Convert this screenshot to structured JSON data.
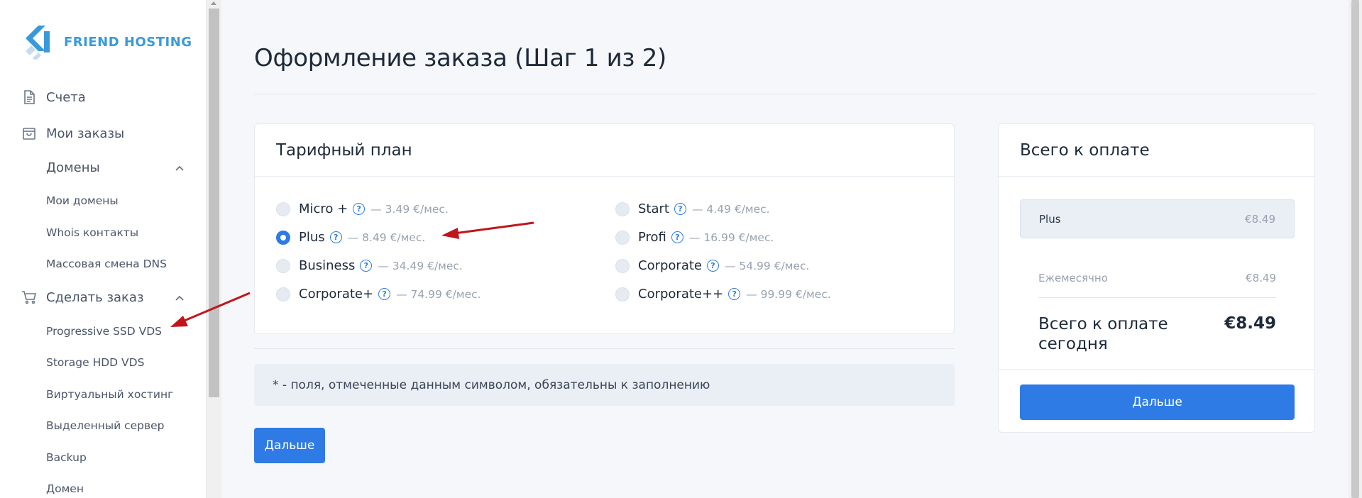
{
  "brand": {
    "name": "FRIEND HOSTING",
    "color": "#3a9ad9"
  },
  "sidebar": {
    "items": [
      {
        "label": "Счета",
        "icon": "document-icon"
      },
      {
        "label": "Мои заказы",
        "icon": "shopping-bag-icon"
      }
    ],
    "domains_group": {
      "label": "Домены",
      "items": [
        "Мои домены",
        "Whois контакты",
        "Массовая смена DNS"
      ]
    },
    "order_group": {
      "label": "Сделать заказ",
      "icon": "cart-icon",
      "items": [
        "Progressive SSD VDS",
        "Storage HDD VDS",
        "Виртуальный хостинг",
        "Выделенный сервер",
        "Backup",
        "Домен"
      ]
    }
  },
  "main": {
    "title": "Оформление заказа (Шаг 1 из 2)",
    "plan_card": {
      "title": "Тарифный план",
      "plans": [
        {
          "name": "Micro +",
          "price": "— 3.49 €/мес.",
          "selected": false
        },
        {
          "name": "Start",
          "price": "— 4.49 €/мес.",
          "selected": false
        },
        {
          "name": "Plus",
          "price": "— 8.49 €/мес.",
          "selected": true
        },
        {
          "name": "Profi",
          "price": "— 16.99 €/мес.",
          "selected": false
        },
        {
          "name": "Business",
          "price": "— 34.49 €/мес.",
          "selected": false
        },
        {
          "name": "Corporate",
          "price": "— 54.99 €/мес.",
          "selected": false
        },
        {
          "name": "Corporate+",
          "price": "— 74.99 €/мес.",
          "selected": false
        },
        {
          "name": "Corporate++",
          "price": "— 99.99 €/мес.",
          "selected": false
        }
      ]
    },
    "note": "* - поля, отмеченные данным символом, обязательны к заполнению",
    "next_label": "Дальше"
  },
  "summary": {
    "title": "Всего к оплате",
    "item_name": "Plus",
    "item_price": "€8.49",
    "monthly_label": "Ежемесячно",
    "monthly_value": "€8.49",
    "total_label": "Всего к оплате сегодня",
    "total_value": "€8.49",
    "next_label": "Дальше"
  },
  "colors": {
    "accent": "#2f7be5",
    "annotation_arrow": "#c0161b"
  }
}
